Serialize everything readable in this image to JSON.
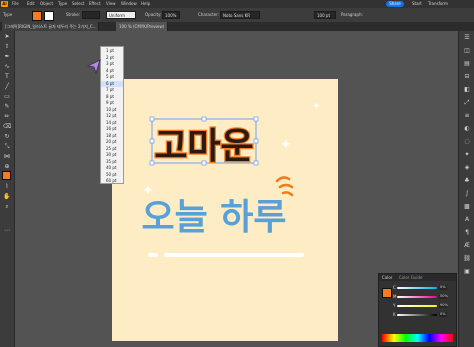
{
  "app": {
    "logo": "Ai"
  },
  "menu": [
    "File",
    "Edit",
    "Object",
    "Type",
    "Select",
    "Effect",
    "View",
    "Window",
    "Help"
  ],
  "menu_right": {
    "share": "Share",
    "ws1": "Start",
    "ws2": "Transform"
  },
  "control": {
    "mode": "Type",
    "stroke_label": "Stroke:",
    "stroke_value": "",
    "stroke_unit": "",
    "profile": "Uniform",
    "opacity_label": "Opacity:",
    "opacity_value": "100%",
    "character_label": "Character:",
    "font_name": "Noto Sans KR",
    "font_size": "100 pt",
    "paragraph_label": "Paragraph:"
  },
  "tabs": {
    "doc": "[그래픽]RIGIN_일러스트 글자 테두리 주는 2가지_C...",
    "view": "100 % (CMYK/Preview)"
  },
  "dropdown_options": [
    "1 pt",
    "2 pt",
    "3 pt",
    "4 pt",
    "5 pt",
    "6 pt",
    "7 pt",
    "8 pt",
    "9 pt",
    "10 pt",
    "12 pt",
    "14 pt",
    "16 pt",
    "18 pt",
    "20 pt",
    "25 pt",
    "30 pt",
    "35 pt",
    "40 pt",
    "50 pt",
    "60 pt",
    "70 pt",
    "80 pt",
    "90 pt",
    "100 pt",
    "200 pt"
  ],
  "dropdown_selected": 5,
  "artwork": {
    "line1": "고마운",
    "line2": "오늘 하루"
  },
  "color_panel": {
    "tab1": "Color",
    "tab2": "Color Guide",
    "labels": [
      "C",
      "M",
      "Y",
      "K"
    ],
    "values": [
      "0%",
      "50%",
      "90%",
      "0%"
    ],
    "colors": {
      "fill": "#f57c20",
      "text_outline": "#2b1a12",
      "blue": "#5aa0d8",
      "orange": "#f07a1e"
    }
  },
  "status": {
    "zoom": "100%",
    "mode": "Selection"
  }
}
